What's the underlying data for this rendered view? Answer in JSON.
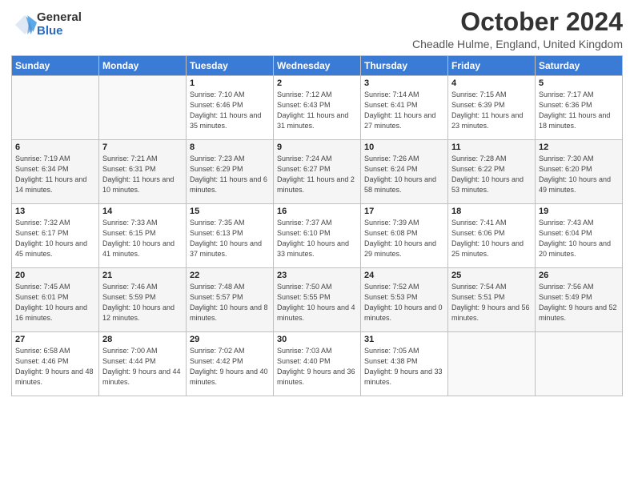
{
  "logo": {
    "general": "General",
    "blue": "Blue"
  },
  "header": {
    "month": "October 2024",
    "location": "Cheadle Hulme, England, United Kingdom"
  },
  "days_of_week": [
    "Sunday",
    "Monday",
    "Tuesday",
    "Wednesday",
    "Thursday",
    "Friday",
    "Saturday"
  ],
  "weeks": [
    [
      {
        "day": "",
        "sunrise": "",
        "sunset": "",
        "daylight": ""
      },
      {
        "day": "",
        "sunrise": "",
        "sunset": "",
        "daylight": ""
      },
      {
        "day": "1",
        "sunrise": "Sunrise: 7:10 AM",
        "sunset": "Sunset: 6:46 PM",
        "daylight": "Daylight: 11 hours and 35 minutes."
      },
      {
        "day": "2",
        "sunrise": "Sunrise: 7:12 AM",
        "sunset": "Sunset: 6:43 PM",
        "daylight": "Daylight: 11 hours and 31 minutes."
      },
      {
        "day": "3",
        "sunrise": "Sunrise: 7:14 AM",
        "sunset": "Sunset: 6:41 PM",
        "daylight": "Daylight: 11 hours and 27 minutes."
      },
      {
        "day": "4",
        "sunrise": "Sunrise: 7:15 AM",
        "sunset": "Sunset: 6:39 PM",
        "daylight": "Daylight: 11 hours and 23 minutes."
      },
      {
        "day": "5",
        "sunrise": "Sunrise: 7:17 AM",
        "sunset": "Sunset: 6:36 PM",
        "daylight": "Daylight: 11 hours and 18 minutes."
      }
    ],
    [
      {
        "day": "6",
        "sunrise": "Sunrise: 7:19 AM",
        "sunset": "Sunset: 6:34 PM",
        "daylight": "Daylight: 11 hours and 14 minutes."
      },
      {
        "day": "7",
        "sunrise": "Sunrise: 7:21 AM",
        "sunset": "Sunset: 6:31 PM",
        "daylight": "Daylight: 11 hours and 10 minutes."
      },
      {
        "day": "8",
        "sunrise": "Sunrise: 7:23 AM",
        "sunset": "Sunset: 6:29 PM",
        "daylight": "Daylight: 11 hours and 6 minutes."
      },
      {
        "day": "9",
        "sunrise": "Sunrise: 7:24 AM",
        "sunset": "Sunset: 6:27 PM",
        "daylight": "Daylight: 11 hours and 2 minutes."
      },
      {
        "day": "10",
        "sunrise": "Sunrise: 7:26 AM",
        "sunset": "Sunset: 6:24 PM",
        "daylight": "Daylight: 10 hours and 58 minutes."
      },
      {
        "day": "11",
        "sunrise": "Sunrise: 7:28 AM",
        "sunset": "Sunset: 6:22 PM",
        "daylight": "Daylight: 10 hours and 53 minutes."
      },
      {
        "day": "12",
        "sunrise": "Sunrise: 7:30 AM",
        "sunset": "Sunset: 6:20 PM",
        "daylight": "Daylight: 10 hours and 49 minutes."
      }
    ],
    [
      {
        "day": "13",
        "sunrise": "Sunrise: 7:32 AM",
        "sunset": "Sunset: 6:17 PM",
        "daylight": "Daylight: 10 hours and 45 minutes."
      },
      {
        "day": "14",
        "sunrise": "Sunrise: 7:33 AM",
        "sunset": "Sunset: 6:15 PM",
        "daylight": "Daylight: 10 hours and 41 minutes."
      },
      {
        "day": "15",
        "sunrise": "Sunrise: 7:35 AM",
        "sunset": "Sunset: 6:13 PM",
        "daylight": "Daylight: 10 hours and 37 minutes."
      },
      {
        "day": "16",
        "sunrise": "Sunrise: 7:37 AM",
        "sunset": "Sunset: 6:10 PM",
        "daylight": "Daylight: 10 hours and 33 minutes."
      },
      {
        "day": "17",
        "sunrise": "Sunrise: 7:39 AM",
        "sunset": "Sunset: 6:08 PM",
        "daylight": "Daylight: 10 hours and 29 minutes."
      },
      {
        "day": "18",
        "sunrise": "Sunrise: 7:41 AM",
        "sunset": "Sunset: 6:06 PM",
        "daylight": "Daylight: 10 hours and 25 minutes."
      },
      {
        "day": "19",
        "sunrise": "Sunrise: 7:43 AM",
        "sunset": "Sunset: 6:04 PM",
        "daylight": "Daylight: 10 hours and 20 minutes."
      }
    ],
    [
      {
        "day": "20",
        "sunrise": "Sunrise: 7:45 AM",
        "sunset": "Sunset: 6:01 PM",
        "daylight": "Daylight: 10 hours and 16 minutes."
      },
      {
        "day": "21",
        "sunrise": "Sunrise: 7:46 AM",
        "sunset": "Sunset: 5:59 PM",
        "daylight": "Daylight: 10 hours and 12 minutes."
      },
      {
        "day": "22",
        "sunrise": "Sunrise: 7:48 AM",
        "sunset": "Sunset: 5:57 PM",
        "daylight": "Daylight: 10 hours and 8 minutes."
      },
      {
        "day": "23",
        "sunrise": "Sunrise: 7:50 AM",
        "sunset": "Sunset: 5:55 PM",
        "daylight": "Daylight: 10 hours and 4 minutes."
      },
      {
        "day": "24",
        "sunrise": "Sunrise: 7:52 AM",
        "sunset": "Sunset: 5:53 PM",
        "daylight": "Daylight: 10 hours and 0 minutes."
      },
      {
        "day": "25",
        "sunrise": "Sunrise: 7:54 AM",
        "sunset": "Sunset: 5:51 PM",
        "daylight": "Daylight: 9 hours and 56 minutes."
      },
      {
        "day": "26",
        "sunrise": "Sunrise: 7:56 AM",
        "sunset": "Sunset: 5:49 PM",
        "daylight": "Daylight: 9 hours and 52 minutes."
      }
    ],
    [
      {
        "day": "27",
        "sunrise": "Sunrise: 6:58 AM",
        "sunset": "Sunset: 4:46 PM",
        "daylight": "Daylight: 9 hours and 48 minutes."
      },
      {
        "day": "28",
        "sunrise": "Sunrise: 7:00 AM",
        "sunset": "Sunset: 4:44 PM",
        "daylight": "Daylight: 9 hours and 44 minutes."
      },
      {
        "day": "29",
        "sunrise": "Sunrise: 7:02 AM",
        "sunset": "Sunset: 4:42 PM",
        "daylight": "Daylight: 9 hours and 40 minutes."
      },
      {
        "day": "30",
        "sunrise": "Sunrise: 7:03 AM",
        "sunset": "Sunset: 4:40 PM",
        "daylight": "Daylight: 9 hours and 36 minutes."
      },
      {
        "day": "31",
        "sunrise": "Sunrise: 7:05 AM",
        "sunset": "Sunset: 4:38 PM",
        "daylight": "Daylight: 9 hours and 33 minutes."
      },
      {
        "day": "",
        "sunrise": "",
        "sunset": "",
        "daylight": ""
      },
      {
        "day": "",
        "sunrise": "",
        "sunset": "",
        "daylight": ""
      }
    ]
  ]
}
